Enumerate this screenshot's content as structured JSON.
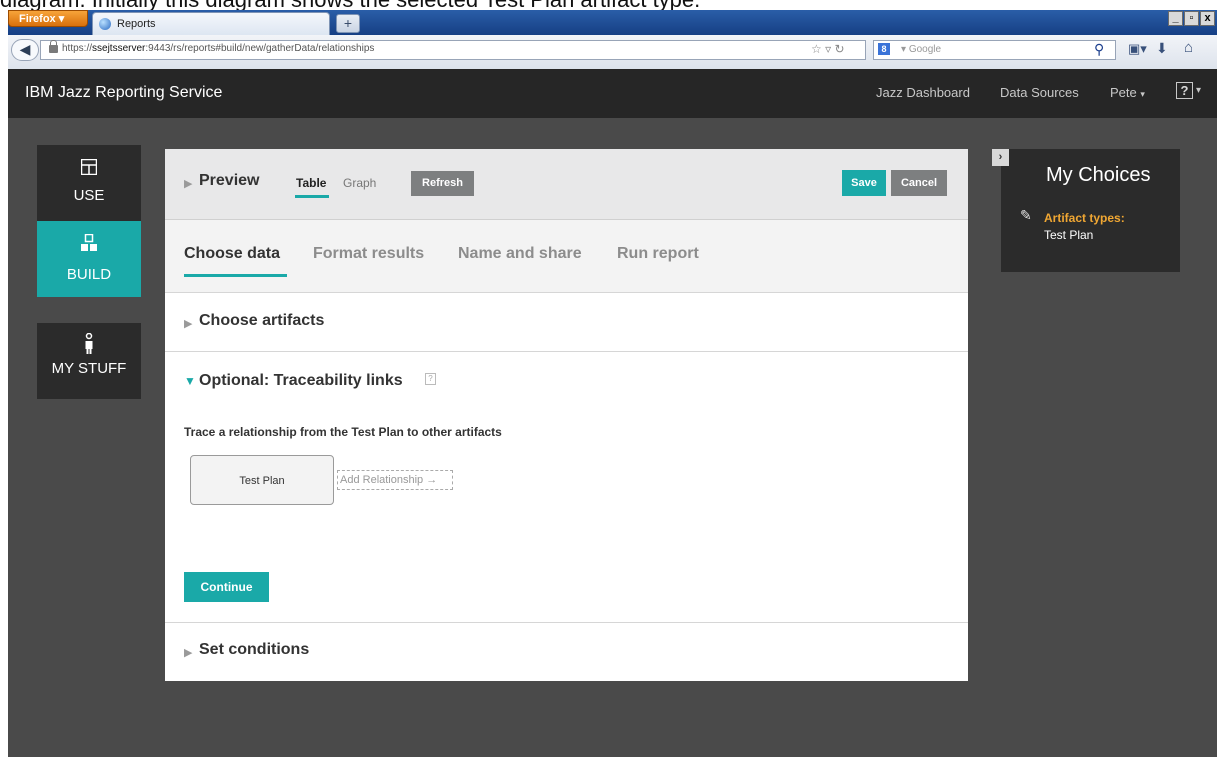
{
  "caption": "diagram. Initially this diagram shows the selected Test Plan artifact type.",
  "browser": {
    "menu_button": "Firefox",
    "tab_title": "Reports",
    "new_tab": "+",
    "window_controls": {
      "minimize": "_",
      "maximize": "▫",
      "close": "x"
    },
    "url_prefix": "https://",
    "url_host": "ssejtsserver",
    "url_rest": ":9443/rs/reports#build/new/gatherData/relationships",
    "search_placeholder": "Google",
    "search_engine_icon": "8"
  },
  "header": {
    "title": "IBM Jazz Reporting Service",
    "links": {
      "dashboard": "Jazz Dashboard",
      "data_sources": "Data Sources",
      "user": "Pete"
    },
    "help": "?"
  },
  "left_nav": {
    "use": "USE",
    "build": "BUILD",
    "my_stuff": "MY STUFF"
  },
  "preview": {
    "title": "Preview",
    "tabs": {
      "table": "Table",
      "graph": "Graph"
    },
    "refresh": "Refresh",
    "save": "Save",
    "cancel": "Cancel"
  },
  "steps": {
    "choose_data": "Choose data",
    "format_results": "Format results",
    "name_and_share": "Name and share",
    "run_report": "Run report"
  },
  "sections": {
    "choose_artifacts": "Choose artifacts",
    "traceability": "Optional: Traceability links",
    "trace_description": "Trace a relationship from the Test Plan to other artifacts",
    "artifact_box": "Test Plan",
    "add_relationship": "Add Relationship",
    "continue": "Continue",
    "set_conditions": "Set conditions"
  },
  "my_choices": {
    "title": "My Choices",
    "label": "Artifact types:",
    "value": "Test Plan"
  },
  "colors": {
    "accent": "#1aa9a8",
    "header_bg": "#262626",
    "app_bg": "#4a4a4a",
    "choices_label": "#f0a733"
  }
}
